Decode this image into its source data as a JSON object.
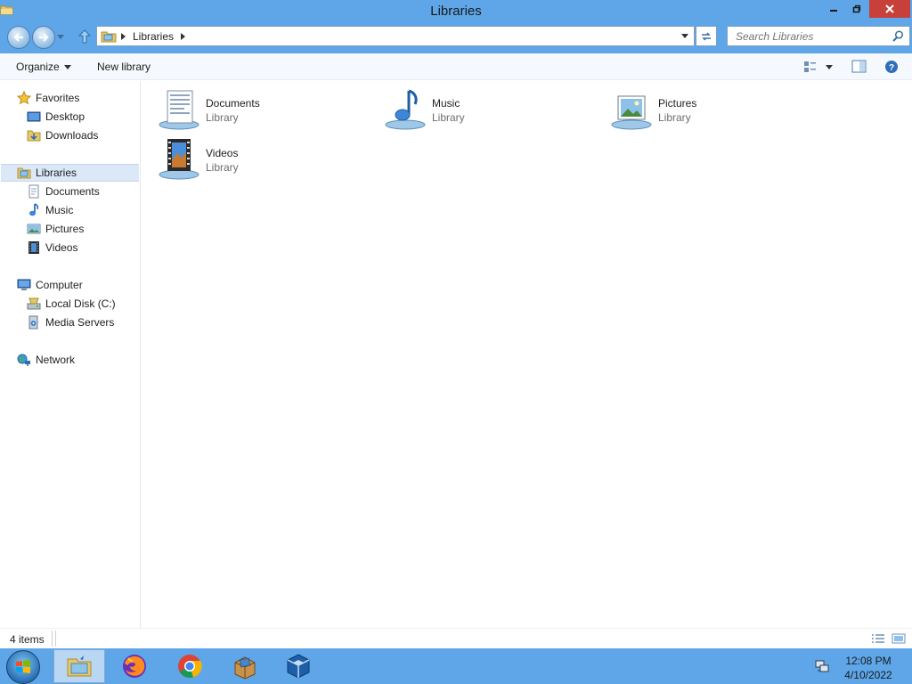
{
  "window": {
    "title": "Libraries"
  },
  "address": {
    "crumb": "Libraries"
  },
  "search": {
    "placeholder": "Search Libraries"
  },
  "toolbar": {
    "organize": "Organize",
    "new_library": "New library"
  },
  "sidebar": {
    "favorites": "Favorites",
    "desktop": "Desktop",
    "downloads": "Downloads",
    "libraries": "Libraries",
    "lib_documents": "Documents",
    "lib_music": "Music",
    "lib_pictures": "Pictures",
    "lib_videos": "Videos",
    "computer": "Computer",
    "local_disk": "Local Disk (C:)",
    "media_servers": "Media Servers",
    "network": "Network"
  },
  "libraries": [
    {
      "name": "Documents",
      "type": "Library"
    },
    {
      "name": "Music",
      "type": "Library"
    },
    {
      "name": "Pictures",
      "type": "Library"
    },
    {
      "name": "Videos",
      "type": "Library"
    }
  ],
  "status": {
    "count": "4 items"
  },
  "clock": {
    "time": "12:08 PM",
    "date": "4/10/2022"
  },
  "colors": {
    "chrome": "#5ea6e8",
    "close": "#c7403a",
    "selection": "#dbe8f8"
  }
}
